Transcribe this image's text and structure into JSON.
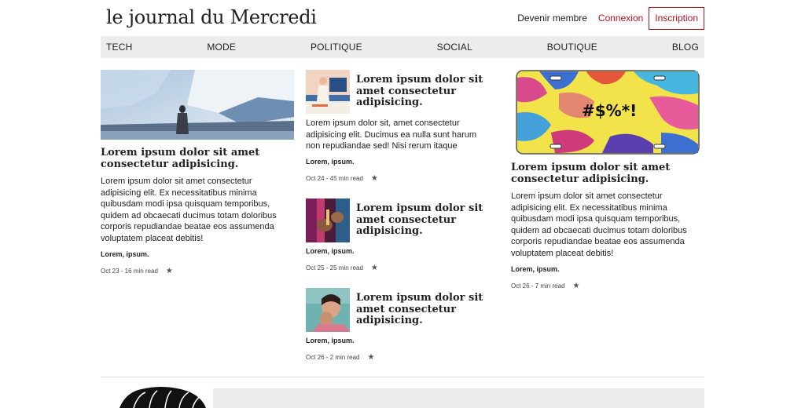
{
  "site": {
    "title": "le journal du Mercredi"
  },
  "header": {
    "member_label": "Devenir membre",
    "login_label": "Connexion",
    "signup_label": "Inscription"
  },
  "nav": {
    "items": [
      "TECH",
      "MODE",
      "POLITIQUE",
      "SOCIAL",
      "BOUTIQUE",
      "BLOG"
    ]
  },
  "articles": {
    "left": {
      "title": "Lorem ipsum dolor sit amet consectetur adipisicing.",
      "excerpt": "Lorem ipsum dolor sit amet consectetur adipisicing elit. Ex necessitatibus minima quibusdam modi ipsa quisquam temporibus, quidem ad obcaecati ducimus totam doloribus corporis repudiandae beatae eos assumenda voluptatem placeat debitis!",
      "author": "Lorem, ipsum.",
      "meta": "Oct 23 - 16 min read"
    },
    "middle": [
      {
        "title": "Lorem ipsum dolor sit amet consectetur adipisicing.",
        "excerpt": "Lorem ipsum dolor sit, amet consectetur adipisicing elit. Ducimus ea nulla sunt harum non repudiandae sed! Nisi rerum itaque",
        "author": "Lorem, ipsum.",
        "meta": "Oct 24 - 45 min read"
      },
      {
        "title": "Lorem ipsum dolor sit amet consectetur adipisicing.",
        "author": "Lorem, ipsum.",
        "meta": "Oct 25 - 25 min read"
      },
      {
        "title": "Lorem ipsum dolor sit amet consectetur adipisicing.",
        "author": "Lorem, ipsum.",
        "meta": "Oct 26 - 2 min read"
      }
    ],
    "right": {
      "plate_text": "#$%*!",
      "title": "Lorem ipsum dolor sit amet consectetur adipisicing.",
      "excerpt": "Lorem ipsum dolor sit amet consectetur adipisicing elit. Ex necessitatibus minima quibusdam modi ipsa quisquam temporibus, quidem ad obcaecati ducimus totam doloribus corporis repudiandae beatae eos assumenda voluptatem placeat debitis!",
      "author": "Lorem, ipsum.",
      "meta": "Oct 26 - 7 min read"
    }
  },
  "icons": {
    "star": "star-icon"
  },
  "colors": {
    "accent": "#b3121d",
    "nav_bg": "#ececec",
    "text": "#222222"
  }
}
